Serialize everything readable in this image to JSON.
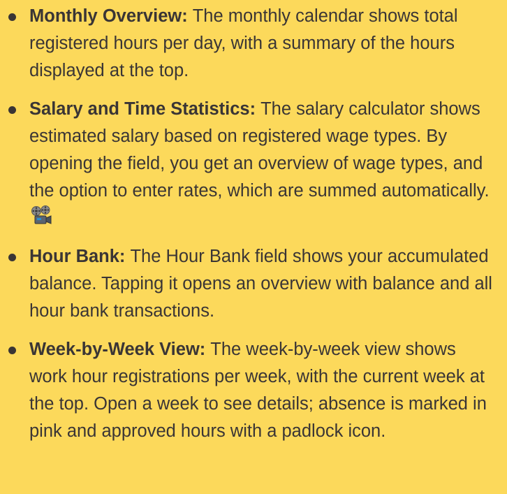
{
  "items": [
    {
      "title": "Monthly Overview:",
      "text": "The monthly calendar shows total registered hours per day, with a summary of the hours displayed at the top."
    },
    {
      "title": "Salary and Time Statistics:",
      "text": "The salary calculator shows estimated salary based on registered wage types. By opening the field, you get an overview of wage types, and the option to enter rates, which are summed automatically.",
      "icon": "film-projector-icon"
    },
    {
      "title": "Hour Bank:",
      "text": "The Hour Bank field shows your accumulated balance. Tapping it opens an overview with balance and all hour bank transactions."
    },
    {
      "title": "Week-by-Week View:",
      "text": "The week-by-week view shows work hour registrations per week, with the current week at the top. Open a week to see details; absence is marked in pink and approved hours with a padlock icon."
    }
  ],
  "colors": {
    "background": "#fcd95b",
    "text": "#3a3535"
  }
}
